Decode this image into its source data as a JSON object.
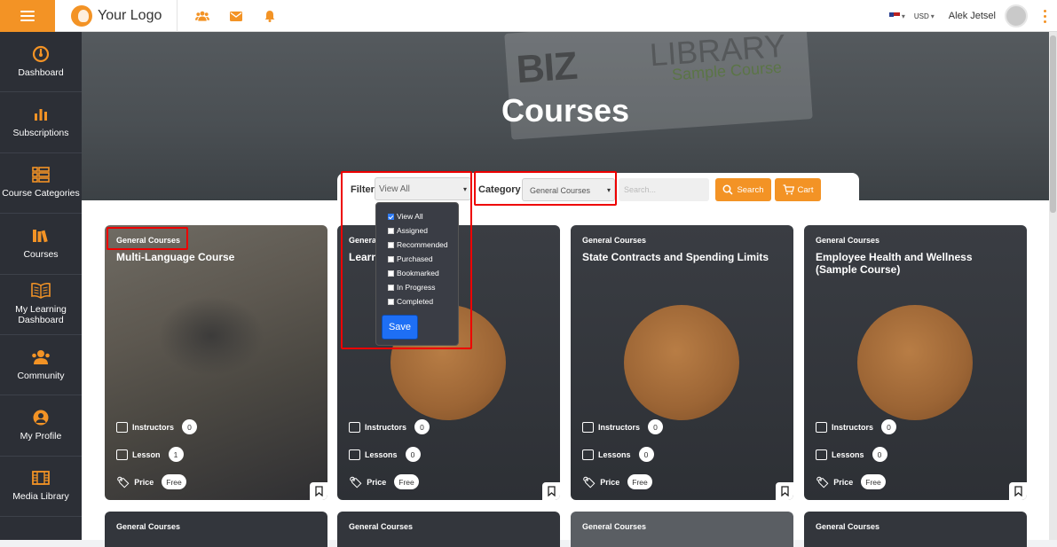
{
  "header": {
    "logo_text": "Your Logo",
    "currency": "USD",
    "user_name": "Alek Jetsel"
  },
  "sidebar": {
    "items": [
      {
        "label": "Dashboard",
        "icon": "dashboard-icon"
      },
      {
        "label": "Subscriptions",
        "icon": "bar-chart-icon"
      },
      {
        "label": "Course Categories",
        "icon": "list-icon"
      },
      {
        "label": "Courses",
        "icon": "books-icon"
      },
      {
        "label": "My Learning Dashboard",
        "icon": "open-book-icon"
      },
      {
        "label": "Community",
        "icon": "community-icon"
      },
      {
        "label": "My Profile",
        "icon": "user-icon"
      },
      {
        "label": "Media Library",
        "icon": "film-icon"
      }
    ]
  },
  "hero": {
    "title": "Courses",
    "banner_brand": "BIZ",
    "banner_brand2": "LIBRARY",
    "banner_sub": "Sample Course"
  },
  "filters": {
    "filter_label": "Filter",
    "filter_value": "View All",
    "category_label": "Category",
    "category_value": "General Courses",
    "search_placeholder": "Search...",
    "search_btn": "Search",
    "cart_btn": "Cart",
    "options": [
      {
        "label": "View All",
        "checked": true
      },
      {
        "label": "Assigned",
        "checked": false
      },
      {
        "label": "Recommended",
        "checked": false
      },
      {
        "label": "Purchased",
        "checked": false
      },
      {
        "label": "Bookmarked",
        "checked": false
      },
      {
        "label": "In Progress",
        "checked": false
      },
      {
        "label": "Completed",
        "checked": false
      }
    ],
    "save_btn": "Save"
  },
  "cards": [
    {
      "category": "General Courses",
      "title": "Multi-Language Course",
      "instructors_label": "Instructors",
      "instructors": "0",
      "lessons_label": "Lesson",
      "lessons": "1",
      "price_label": "Price",
      "price": "Free"
    },
    {
      "category": "General Courses",
      "title": "Learn",
      "instructors_label": "Instructors",
      "instructors": "0",
      "lessons_label": "Lessons",
      "lessons": "0",
      "price_label": "Price",
      "price": "Free"
    },
    {
      "category": "General Courses",
      "title": "State Contracts and Spending Limits",
      "instructors_label": "Instructors",
      "instructors": "0",
      "lessons_label": "Lessons",
      "lessons": "0",
      "price_label": "Price",
      "price": "Free"
    },
    {
      "category": "General Courses",
      "title": "Employee Health and Wellness (Sample Course)",
      "instructors_label": "Instructors",
      "instructors": "0",
      "lessons_label": "Lessons",
      "lessons": "0",
      "price_label": "Price",
      "price": "Free"
    }
  ],
  "cards_row2": [
    {
      "category": "General Courses"
    },
    {
      "category": "General Courses"
    },
    {
      "category": "General Courses"
    },
    {
      "category": "General Courses"
    }
  ],
  "colors": {
    "accent": "#f39325",
    "sidebar": "#2c2f36",
    "highlight": "#ee0000",
    "save": "#1e6ff5"
  }
}
